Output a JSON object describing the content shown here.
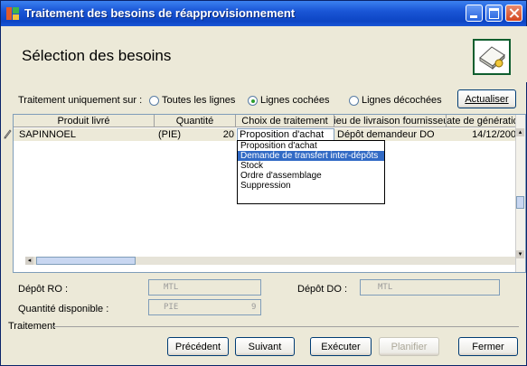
{
  "window": {
    "title": "Traitement des besoins de réapprovisionnement"
  },
  "header": {
    "page_title": "Sélection des besoins",
    "icon": "document-hand-icon"
  },
  "filter": {
    "label": "Traitement uniquement sur :",
    "options": [
      {
        "label": "Toutes les lignes",
        "selected": false
      },
      {
        "label": "Lignes cochées",
        "selected": true
      },
      {
        "label": "Lignes décochées",
        "selected": false
      }
    ],
    "refresh_label": "Actualiser"
  },
  "grid": {
    "columns": [
      "Produit livré",
      "Quantité",
      "Choix de traitement",
      "Lieu de livraison fournisseur",
      "Date de génération"
    ],
    "row": {
      "produit": "SAPINNOEL",
      "unit": "(PIE)",
      "quantite": "20",
      "choix": "Proposition d'achat",
      "lieu": "Dépôt demandeur DO",
      "date": "14/12/200"
    },
    "dropdown_options": [
      "Proposition d'achat",
      "Demande de transfert inter-dépôts",
      "Stock",
      "Ordre d'assemblage",
      "Suppression"
    ],
    "selected_option_index": 1
  },
  "details": {
    "depot_ro_label": "Dépôt RO :",
    "depot_ro_value": "MTL",
    "depot_do_label": "Dépôt DO :",
    "depot_do_value": "MTL",
    "qty_label": "Quantité disponible :",
    "qty_unit": "PIE",
    "qty_value": "9",
    "traitement_label": "Traitement"
  },
  "buttons": {
    "previous": "Précédent",
    "next": "Suivant",
    "execute": "Exécuter",
    "plan": "Planifier",
    "close": "Fermer"
  }
}
